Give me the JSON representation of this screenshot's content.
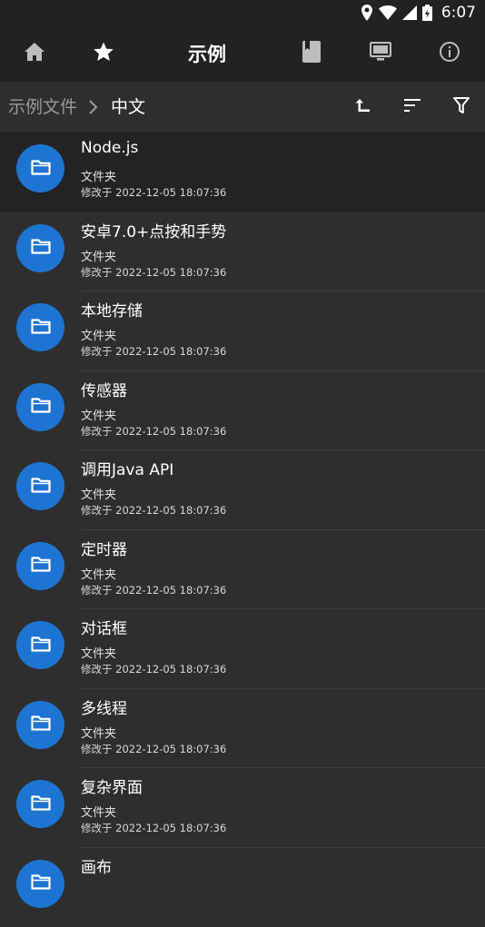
{
  "status": {
    "time": "6:07"
  },
  "appbar": {
    "title": "示例",
    "icons": [
      "home-icon",
      "star-icon",
      "book-icon",
      "monitor-icon",
      "info-icon"
    ]
  },
  "path": {
    "parent": "示例文件",
    "current": "中文"
  },
  "files": [
    {
      "name": "Node.js",
      "type": "文件夹",
      "meta": "修改于 2022-12-05 18:07:36"
    },
    {
      "name": "安卓7.0+点按和手势",
      "type": "文件夹",
      "meta": "修改于 2022-12-05 18:07:36"
    },
    {
      "name": "本地存储",
      "type": "文件夹",
      "meta": "修改于 2022-12-05 18:07:36"
    },
    {
      "name": "传感器",
      "type": "文件夹",
      "meta": "修改于 2022-12-05 18:07:36"
    },
    {
      "name": "调用Java API",
      "type": "文件夹",
      "meta": "修改于 2022-12-05 18:07:36"
    },
    {
      "name": "定时器",
      "type": "文件夹",
      "meta": "修改于 2022-12-05 18:07:36"
    },
    {
      "name": "对话框",
      "type": "文件夹",
      "meta": "修改于 2022-12-05 18:07:36"
    },
    {
      "name": "多线程",
      "type": "文件夹",
      "meta": "修改于 2022-12-05 18:07:36"
    },
    {
      "name": "复杂界面",
      "type": "文件夹",
      "meta": "修改于 2022-12-05 18:07:36"
    },
    {
      "name": "画布",
      "type": "",
      "meta": ""
    }
  ],
  "colors": {
    "folder_accent": "#1e74d2",
    "background": "#2e2e2e",
    "toolbar": "#222222"
  }
}
